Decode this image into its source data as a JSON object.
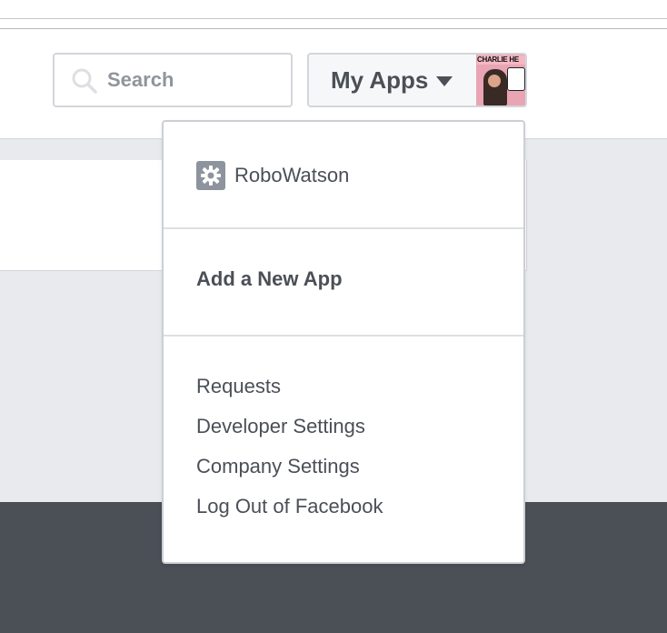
{
  "header": {
    "search": {
      "placeholder": "Search",
      "value": ""
    },
    "my_apps_label": "My Apps",
    "avatar_text": "CHARLIE HE"
  },
  "dropdown": {
    "apps": [
      {
        "name": "RoboWatson",
        "icon": "gear-icon"
      }
    ],
    "add_app_label": "Add a New App",
    "links": [
      {
        "label": "Requests"
      },
      {
        "label": "Developer Settings"
      },
      {
        "label": "Company Settings"
      },
      {
        "label": "Log Out of Facebook"
      }
    ]
  },
  "colors": {
    "page_bg": "#e9eaed",
    "text": "#4b4f56",
    "muted": "#90949c",
    "border": "#d3d6db",
    "footer": "#4b4f56"
  }
}
